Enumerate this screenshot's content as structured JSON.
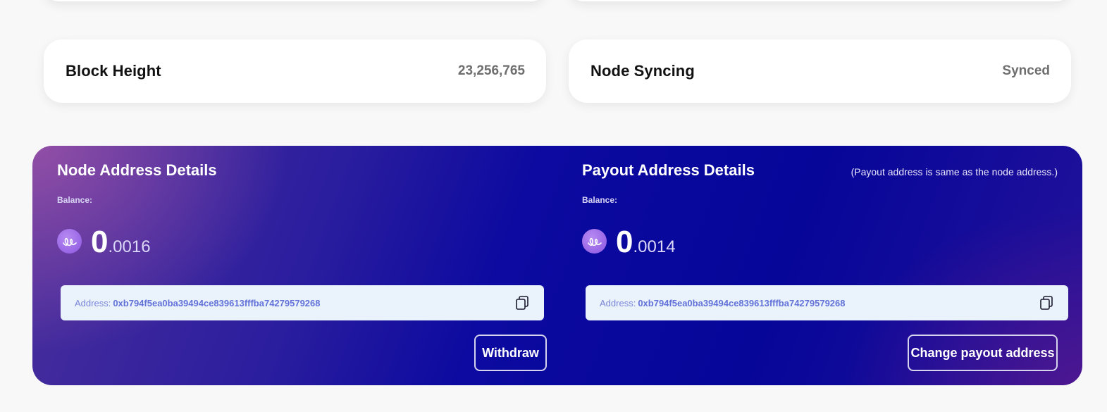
{
  "stats": {
    "block_height": {
      "label": "Block Height",
      "value": "23,256,765"
    },
    "node_syncing": {
      "label": "Node Syncing",
      "value": "Synced"
    }
  },
  "node": {
    "title": "Node Address Details",
    "balance_label": "Balance:",
    "balance_integer": "0",
    "balance_decimal": ".0016",
    "address_prefix": "Address:",
    "address": "0xb794f5ea0ba39494ce839613fffba74279579268",
    "coin_icon": "energy-web-token-icon",
    "copy_icon": "copy-icon",
    "button_label": "Withdraw"
  },
  "payout": {
    "title": "Payout Address Details",
    "note": "(Payout address is same as the node address.)",
    "balance_label": "Balance:",
    "balance_integer": "0",
    "balance_decimal": ".0014",
    "address_prefix": "Address:",
    "address": "0xb794f5ea0ba39494ce839613fffba74279579268",
    "coin_icon": "energy-web-token-icon",
    "copy_icon": "copy-icon",
    "button_label": "Change payout address"
  },
  "colors": {
    "page_background": "#f8f8f8",
    "panel_primary": "#060699",
    "panel_accent": "#aa5aaa",
    "coin": "#8b56e0",
    "address_box": "#eaf2fc",
    "address_text": "#6272d8"
  }
}
